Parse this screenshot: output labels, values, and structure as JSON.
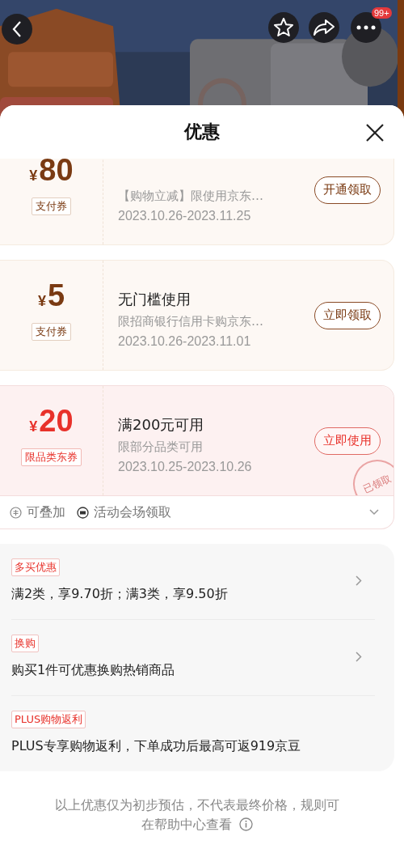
{
  "top_bar": {
    "badge": "99+"
  },
  "sheet": {
    "title": "优惠"
  },
  "coupons": [
    {
      "kind": "payment",
      "currency": "¥",
      "amount": "80",
      "tag": "支付券",
      "desc": "【购物立减】限使用京东…",
      "date": "2023.10.26-2023.11.25",
      "button": "开通领取"
    },
    {
      "kind": "payment",
      "currency": "¥",
      "amount": "5",
      "tag": "支付券",
      "title": "无门槛使用",
      "desc": "限招商银行信用卡购京东…",
      "date": "2023.10.26-2023.11.01",
      "button": "立即领取"
    },
    {
      "kind": "category",
      "currency": "¥",
      "amount": "20",
      "tag": "限品类东券",
      "title": "满200元可用",
      "desc": "限部分品类可用",
      "date": "2023.10.25-2023.10.26",
      "button": "立即使用",
      "stamp": "已领取",
      "features": [
        "可叠加",
        "活动会场领取"
      ],
      "expanded": false
    }
  ],
  "promotions": [
    {
      "tag": "多买优惠",
      "text": "满2类，享9.70折；满3类，享9.50折",
      "has_arrow": true
    },
    {
      "tag": "换购",
      "text": "购买1件可优惠换购热销商品",
      "has_arrow": true
    },
    {
      "tag": "PLUS购物返利",
      "text": "PLUS专享购物返利，下单成功后最高可返919京豆",
      "has_arrow": false
    }
  ],
  "footer_note": "以上优惠仅为初步预估，不代表最终价格，规则可在帮助中心查看"
}
